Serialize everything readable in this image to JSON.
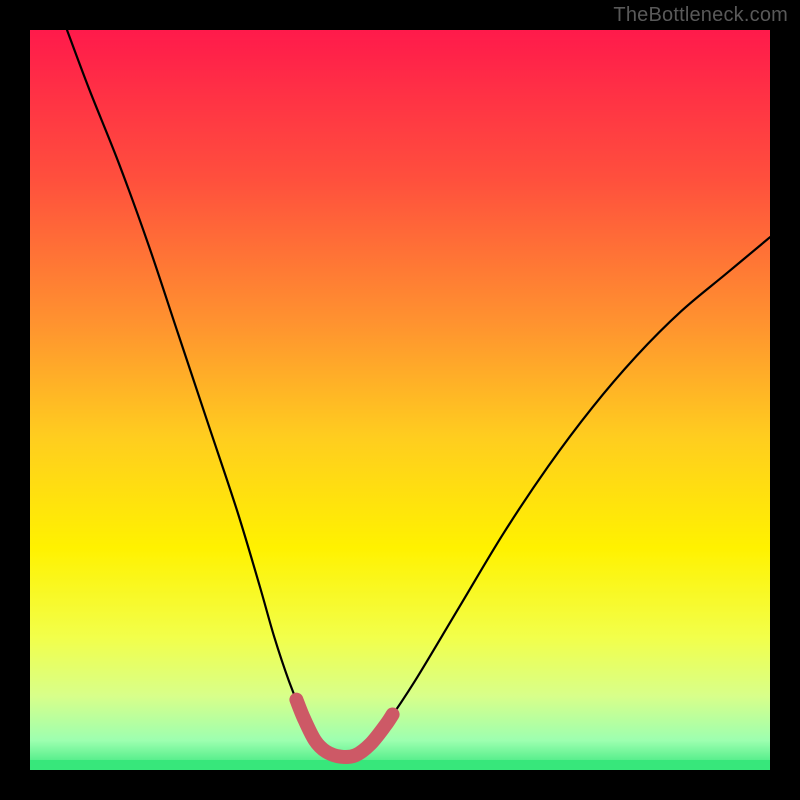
{
  "watermark": "TheBottleneck.com",
  "colors": {
    "frame": "#000000",
    "curve": "#000000",
    "highlight": "#cd5966",
    "green_band": "#37e77b",
    "watermark_text": "#595959"
  },
  "chart_data": {
    "type": "line",
    "title": "",
    "xlabel": "",
    "ylabel": "",
    "xlim": [
      0,
      100
    ],
    "ylim": [
      0,
      100
    ],
    "background": {
      "kind": "vertical_gradient",
      "stops": [
        {
          "offset": 0.0,
          "color": "#ff1a4b"
        },
        {
          "offset": 0.2,
          "color": "#ff4f3d"
        },
        {
          "offset": 0.4,
          "color": "#ff942f"
        },
        {
          "offset": 0.55,
          "color": "#ffcd1f"
        },
        {
          "offset": 0.7,
          "color": "#fff200"
        },
        {
          "offset": 0.82,
          "color": "#f2ff4a"
        },
        {
          "offset": 0.9,
          "color": "#d8ff8a"
        },
        {
          "offset": 0.96,
          "color": "#9dffb0"
        },
        {
          "offset": 1.0,
          "color": "#37e77b"
        }
      ]
    },
    "series": [
      {
        "name": "bottleneck-curve",
        "x": [
          5,
          8,
          12,
          16,
          20,
          24,
          28,
          31,
          33,
          35,
          37,
          38.5,
          40,
          42,
          44,
          46,
          48,
          52,
          58,
          64,
          70,
          76,
          82,
          88,
          94,
          100
        ],
        "y": [
          100,
          92,
          82,
          71,
          59,
          47,
          35,
          25,
          18,
          12,
          7,
          4,
          2.5,
          1.8,
          2.0,
          3.5,
          6,
          12,
          22,
          32,
          41,
          49,
          56,
          62,
          67,
          72
        ]
      }
    ],
    "highlight_segment": {
      "series": "bottleneck-curve",
      "x_start": 36,
      "x_end": 49,
      "note": "thick rounded pink stroke over curve near minimum"
    },
    "curve_minimum": {
      "x": 43,
      "y": 1.8
    }
  }
}
